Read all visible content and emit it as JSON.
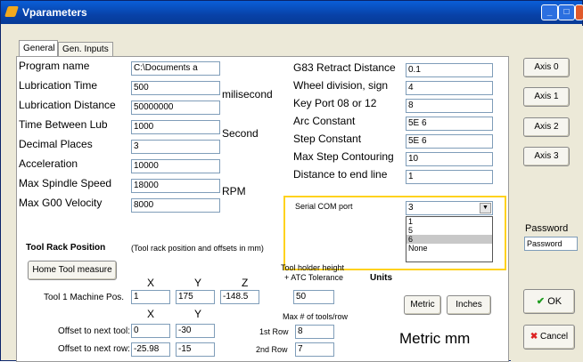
{
  "window": {
    "title": "Vparameters"
  },
  "tabs": [
    "General",
    "Gen. Inputs"
  ],
  "left_params": [
    {
      "label": "Program name",
      "value": "C:\\Documents a",
      "unit": ""
    },
    {
      "label": "Lubrication Time",
      "value": "500",
      "unit": "milisecond"
    },
    {
      "label": "Lubrication Distance",
      "value": "50000000",
      "unit": ""
    },
    {
      "label": "Time Between Lub",
      "value": "1000",
      "unit": "Second"
    },
    {
      "label": "Decimal Places",
      "value": "3",
      "unit": ""
    },
    {
      "label": "Acceleration",
      "value": "10000",
      "unit": ""
    },
    {
      "label": "Max Spindle Speed",
      "value": "18000",
      "unit": "RPM"
    },
    {
      "label": "Max G00 Velocity",
      "value": "8000",
      "unit": ""
    }
  ],
  "right_params": [
    {
      "label": "G83 Retract Distance",
      "value": "0.1"
    },
    {
      "label": "Wheel division, sign",
      "value": "4"
    },
    {
      "label": "Key Port 08 or 12",
      "value": "8"
    },
    {
      "label": "Arc Constant",
      "value": "5E 6"
    },
    {
      "label": "Step Constant",
      "value": "5E 6"
    },
    {
      "label": "Max Step Contouring",
      "value": "10"
    },
    {
      "label": "Distance to end line",
      "value": "1"
    }
  ],
  "serial": {
    "label": "Serial COM port",
    "value": "3",
    "options": [
      "1",
      "5",
      "6",
      "None"
    ],
    "selected_option": "6"
  },
  "tool_rack": {
    "title": "Tool Rack Position",
    "note": "(Tool rack position and offsets in mm)",
    "home_button": "Home Tool measure",
    "col_x": "X",
    "col_y": "Y",
    "col_z": "Z",
    "tool1_label": "Tool 1 Machine Pos.",
    "tool1": [
      "1",
      "175",
      "-148.5"
    ],
    "col_x2": "X",
    "col_y2": "Y",
    "offset_tool_label": "Offset to next tool:",
    "offset_tool": [
      "0",
      "-30"
    ],
    "offset_row_label": "Offset to next row:",
    "offset_row": [
      "-25.98",
      "-15"
    ],
    "holder_label1": "Tool holder height",
    "holder_label2": "+ ATC Tolerance",
    "holder_value": "50",
    "max_tools_label": "Max # of tools/row",
    "row1_label": "1st Row",
    "row1_value": "8",
    "row2_label": "2nd Row",
    "row2_value": "7"
  },
  "units": {
    "title": "Units",
    "metric_button": "Metric",
    "inches_button": "Inches",
    "display": "Metric mm"
  },
  "axis_buttons": [
    "Axis 0",
    "Axis 1",
    "Axis 2",
    "Axis 3"
  ],
  "password": {
    "label": "Password",
    "value": "Password"
  },
  "ok_label": "OK",
  "cancel_label": "Cancel",
  "colors": {
    "title_bar": "#0a5fd8",
    "highlight": "#ffd21e",
    "window_bg": "#ece9d8"
  }
}
